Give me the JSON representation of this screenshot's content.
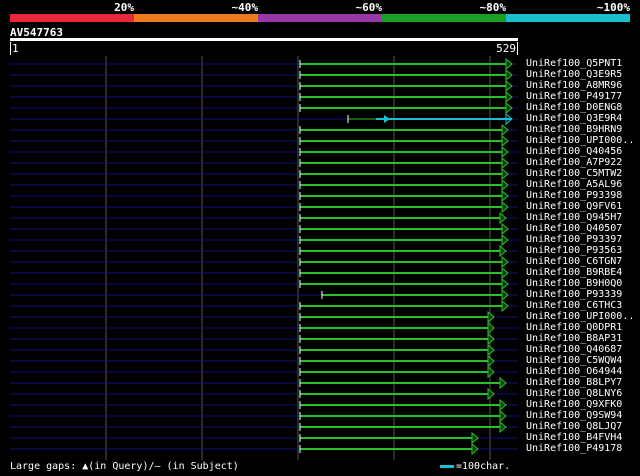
{
  "percent_scale": {
    "labels": [
      "20%",
      "~40%",
      "~60%",
      "~80%",
      "~100%"
    ],
    "colors": [
      "#e8283a",
      "#ee7a1c",
      "#9a38a8",
      "#1ca024",
      "#19c0cc"
    ]
  },
  "query": {
    "id": "AV547763",
    "start": "1",
    "end": "529"
  },
  "colors": {
    "hit": "#28c028",
    "hit_best": "#19c0d0",
    "background_line": "#10107a",
    "gridline": "#555555"
  },
  "hits": [
    {
      "label": "UniRef100_Q5PNT1",
      "type": "green"
    },
    {
      "label": "UniRef100_Q3E9R5",
      "type": "green"
    },
    {
      "label": "UniRef100_A8MR96",
      "type": "green"
    },
    {
      "label": "UniRef100_P49177",
      "type": "green"
    },
    {
      "label": "UniRef100_D0ENG8",
      "type": "green"
    },
    {
      "label": "UniRef100_Q3E9R4",
      "type": "cyan"
    },
    {
      "label": "UniRef100_B9HRN9",
      "type": "green"
    },
    {
      "label": "UniRef100_UPI000..",
      "type": "green"
    },
    {
      "label": "UniRef100_Q40456",
      "type": "green"
    },
    {
      "label": "UniRef100_A7P922",
      "type": "green"
    },
    {
      "label": "UniRef100_C5MTW2",
      "type": "green"
    },
    {
      "label": "UniRef100_A5AL96",
      "type": "green"
    },
    {
      "label": "UniRef100_P93398",
      "type": "green"
    },
    {
      "label": "UniRef100_Q9FV61",
      "type": "green"
    },
    {
      "label": "UniRef100_Q945H7",
      "type": "green"
    },
    {
      "label": "UniRef100_Q40507",
      "type": "green"
    },
    {
      "label": "UniRef100_P93397",
      "type": "green"
    },
    {
      "label": "UniRef100_P93563",
      "type": "green"
    },
    {
      "label": "UniRef100_C6TGN7",
      "type": "green"
    },
    {
      "label": "UniRef100_B9RBE4",
      "type": "green"
    },
    {
      "label": "UniRef100_B9H0Q0",
      "type": "green"
    },
    {
      "label": "UniRef100_P93339",
      "type": "green"
    },
    {
      "label": "UniRef100_C6THC3",
      "type": "green"
    },
    {
      "label": "UniRef100_UPI000..",
      "type": "green"
    },
    {
      "label": "UniRef100_Q0DPR1",
      "type": "green"
    },
    {
      "label": "UniRef100_B8AP31",
      "type": "green"
    },
    {
      "label": "UniRef100_Q40687",
      "type": "green"
    },
    {
      "label": "UniRef100_C5WQW4",
      "type": "green"
    },
    {
      "label": "UniRef100_O64944",
      "type": "green"
    },
    {
      "label": "UniRef100_B8LPY7",
      "type": "green"
    },
    {
      "label": "UniRef100_Q8LNY6",
      "type": "green"
    },
    {
      "label": "UniRef100_Q9XFK0",
      "type": "green"
    },
    {
      "label": "UniRef100_Q9SW94",
      "type": "green"
    },
    {
      "label": "UniRef100_Q8LJQ7",
      "type": "green"
    },
    {
      "label": "UniRef100_B4FVH4",
      "type": "green"
    },
    {
      "label": "UniRef100_P49178",
      "type": "green"
    }
  ],
  "footer": {
    "gaps_text": "Large gaps: ▲(in Query)/— (in Subject)",
    "scale_text": "=100char."
  }
}
